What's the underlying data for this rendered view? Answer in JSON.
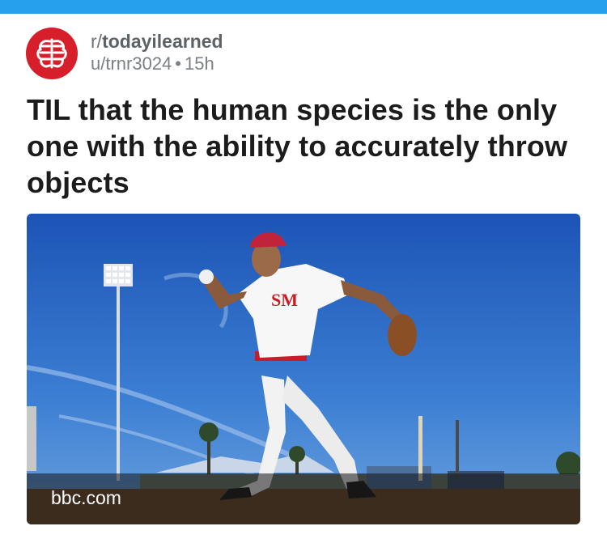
{
  "header": {
    "accent_color": "#24a0ed"
  },
  "post": {
    "subreddit_prefix": "r/",
    "subreddit_name": "todayilearned",
    "user": "u/trnr3024",
    "separator": "•",
    "age": "15h",
    "title": "TIL that the human species is the only one with the ability to accurately throw objects",
    "link_domain": "bbc.com",
    "avatar_icon": "brain-icon",
    "avatar_color": "#d71f2b",
    "image_icon": "baseball-pitcher-photo",
    "jersey_text": "SM"
  }
}
